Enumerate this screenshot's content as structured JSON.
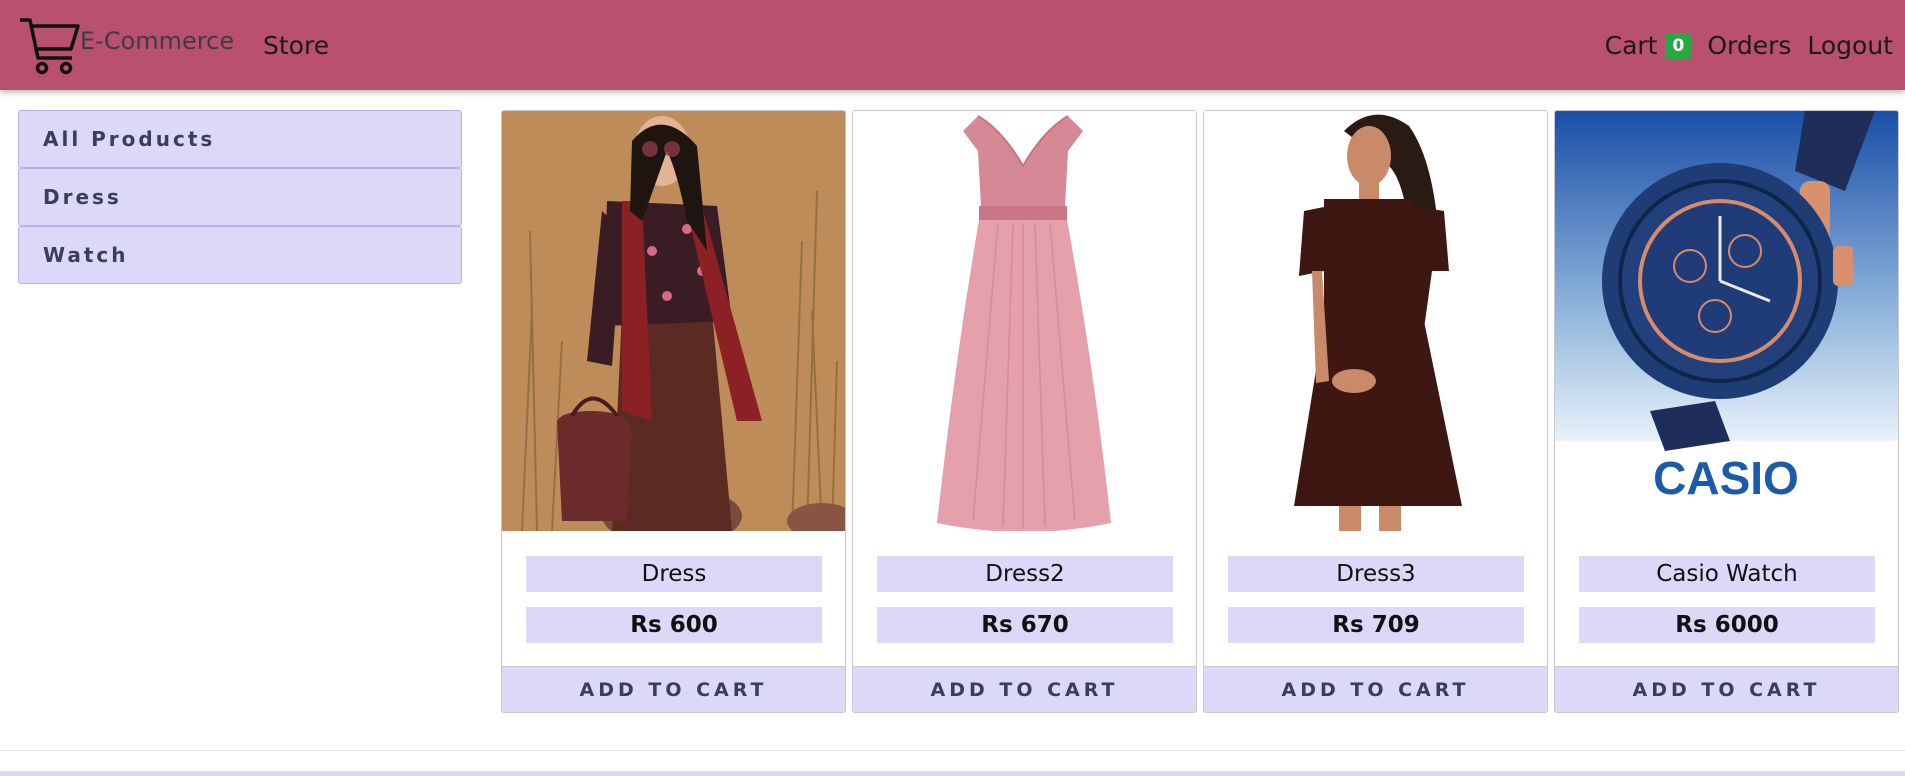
{
  "navbar": {
    "brand": "E-Commerce",
    "brand_icon": "shopping-cart-icon",
    "store": "Store",
    "cart": "Cart",
    "cart_count": "0",
    "orders": "Orders",
    "logout": "Logout",
    "bg_color": "#b9506d"
  },
  "sidebar": {
    "items": [
      {
        "label": "All Products"
      },
      {
        "label": "Dress"
      },
      {
        "label": "Watch"
      }
    ]
  },
  "products": [
    {
      "name": "Dress",
      "price": "Rs 600",
      "button": "ADD TO CART"
    },
    {
      "name": "Dress2",
      "price": "Rs 670",
      "button": "ADD TO CART"
    },
    {
      "name": "Dress3",
      "price": "Rs 709",
      "button": "ADD TO CART"
    },
    {
      "name": "Casio Watch",
      "price": "Rs 6000",
      "button": "ADD TO CART",
      "brand_logo": "CASIO"
    }
  ],
  "colors": {
    "accent_light": "#dcd8f8",
    "badge": "#28a745"
  }
}
